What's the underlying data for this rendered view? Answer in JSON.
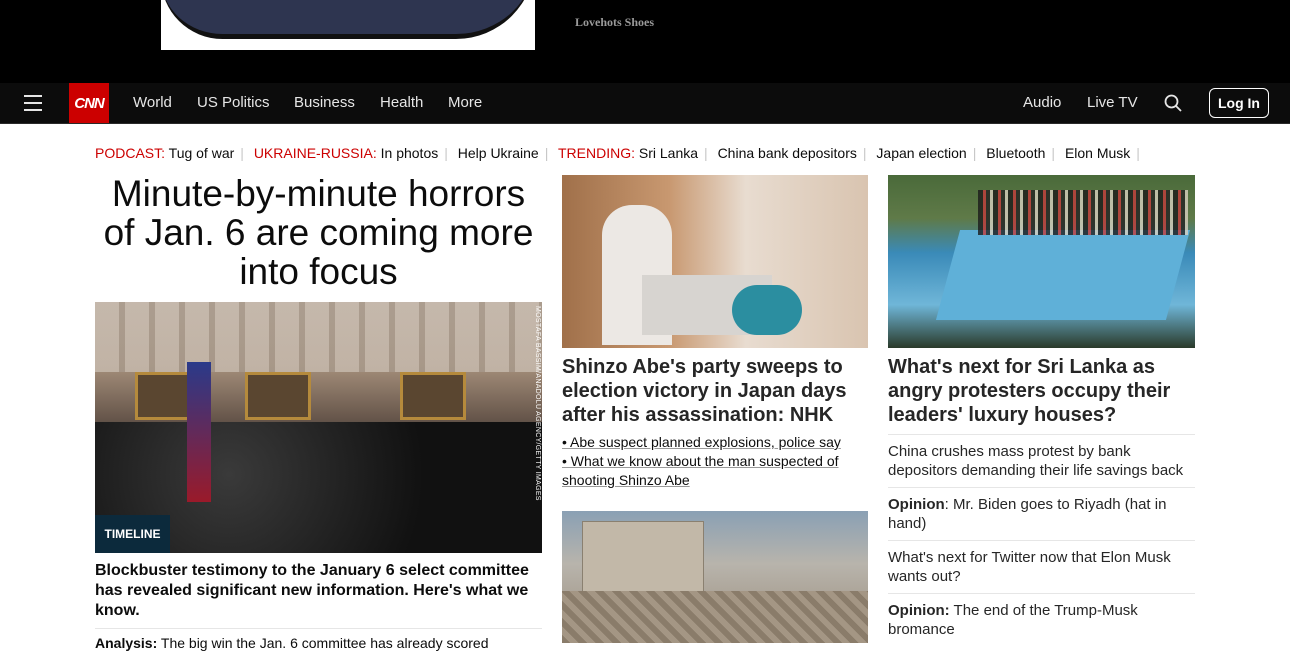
{
  "ad": {
    "brand": "Lovehots Shoes"
  },
  "nav": {
    "logo": "CNN",
    "items": [
      "World",
      "US Politics",
      "Business",
      "Health",
      "More"
    ],
    "audio": "Audio",
    "live_tv": "Live TV",
    "login": "Log In"
  },
  "trending": {
    "podcast_label": "PODCAST:",
    "podcast_text": "Tug of war",
    "ukraine_label": "UKRAINE-RUSSIA:",
    "ukraine_text": "In photos",
    "help": "Help Ukraine",
    "trending_label": "TRENDING:",
    "topics": [
      "Sri Lanka",
      "China bank depositors",
      "Japan election",
      "Bluetooth",
      "Elon Musk"
    ]
  },
  "lead": {
    "headline": "Minute-by-minute horrors of Jan. 6 are coming more into focus",
    "credit": "MOSTAFA BASSIM/ANADOLU AGENCY/GETTY IMAGES",
    "badge": "TIMELINE",
    "subhead": "Blockbuster testimony to the January 6 select committee has revealed significant new information. Here's what we know.",
    "analysis_label": "Analysis:",
    "analysis_text": "The big win the Jan. 6 committee has already scored"
  },
  "japan": {
    "headline": "Shinzo Abe's party sweeps to election victory in Japan days after his assassination: NHK",
    "bullets": [
      "• Abe suspect planned explosions, police say",
      "• What we know about the man suspected of shooting Shinzo Abe"
    ]
  },
  "srilanka": {
    "headline": "What's next for Sri Lanka as angry protesters occupy their leaders' luxury houses?",
    "items": [
      {
        "label": "",
        "text": "China crushes mass protest by bank depositors demanding their life savings back"
      },
      {
        "label": "Opinion",
        "text": ": Mr. Biden goes to Riyadh (hat in hand)"
      },
      {
        "label": "",
        "text": "What's next for Twitter now that Elon Musk wants out?"
      },
      {
        "label": "Opinion:",
        "text": " The end of the Trump-Musk bromance"
      }
    ]
  }
}
